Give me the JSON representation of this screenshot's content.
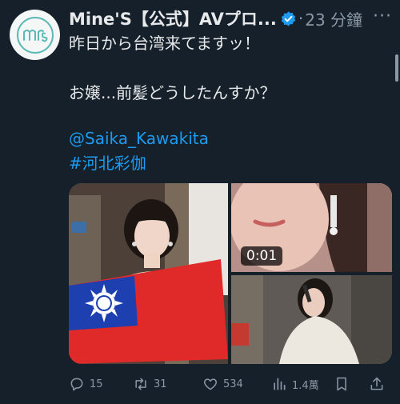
{
  "tweet": {
    "author_name": "Mine'S【公式】AVプロ...",
    "dot": "·",
    "time": "23 分鐘",
    "more": "···",
    "line1": "昨日から台湾来てますッ！",
    "line2": "お嬢...前髪どうしたんすか？",
    "mention": "@Saika_Kawakita",
    "hashtag": "#河北彩伽"
  },
  "media": {
    "video_duration": "0:01"
  },
  "actions": {
    "replies": "15",
    "retweets": "31",
    "likes": "534",
    "views": "1.4萬"
  },
  "colors": {
    "background": "#15202b",
    "link": "#1d9bf0",
    "secondary_text": "#8b98a5",
    "verified_badge": "#1d9bf0",
    "flag_red": "#e02a2a",
    "flag_blue": "#1e3fb0"
  },
  "icons": [
    "verified-badge-icon",
    "reply-icon",
    "retweet-icon",
    "like-icon",
    "views-icon",
    "bookmark-icon",
    "share-icon"
  ]
}
